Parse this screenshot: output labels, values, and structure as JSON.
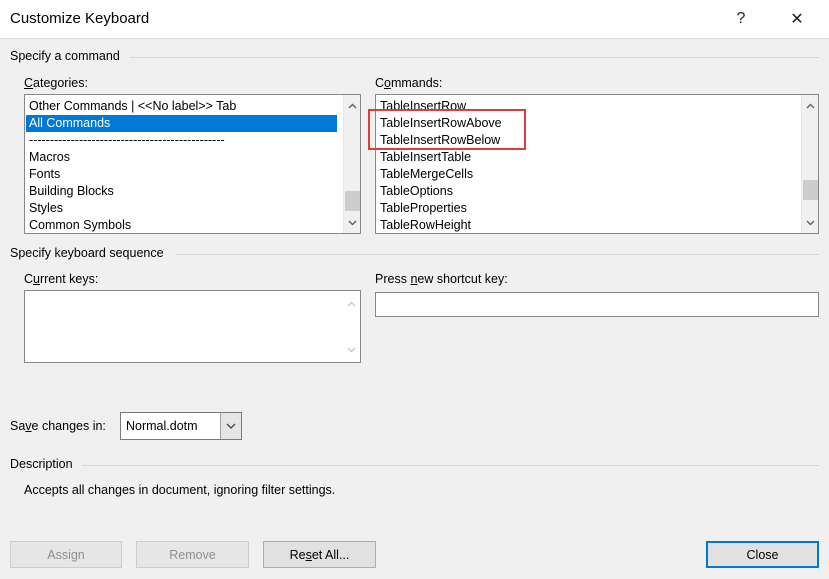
{
  "window": {
    "title": "Customize Keyboard",
    "help_label": "?",
    "close_label": "✕"
  },
  "specify_command": {
    "group_label": "Specify a command",
    "categories_label_u": "C",
    "categories_label_rest": "ategories:",
    "categories": [
      "Other Commands | <<No label>> Tab",
      "All Commands",
      "-----------------------------------------------",
      "Macros",
      "Fonts",
      "Building Blocks",
      "Styles",
      "Common Symbols"
    ],
    "categories_selected": "All Commands",
    "commands_label_u": "o",
    "commands_label_pre": "C",
    "commands_label_rest": "mmands:",
    "commands": [
      "TableInsertRow",
      "TableInsertRowAbove",
      "TableInsertRowBelow",
      "TableInsertTable",
      "TableMergeCells",
      "TableOptions",
      "TableProperties",
      "TableRowHeight"
    ]
  },
  "keyboard_sequence": {
    "group_label": "Specify keyboard sequence",
    "current_keys_label_u": "u",
    "current_keys_label_pre": "C",
    "current_keys_label_rest": "rrent keys:",
    "press_new_label_pre": "Press ",
    "press_new_label_u": "n",
    "press_new_label_rest": "ew shortcut key:",
    "new_shortcut_value": ""
  },
  "save_changes": {
    "label_pre": "Sa",
    "label_u": "v",
    "label_rest": "e changes in:",
    "selected": "Normal.dotm"
  },
  "description": {
    "group_label": "Description",
    "text": "Accepts all changes in document, ignoring filter settings."
  },
  "buttons": {
    "assign": "Assign",
    "remove": "Remove",
    "reset_all_pre": "Re",
    "reset_all_u": "s",
    "reset_all_rest": "et All...",
    "close": "Close"
  }
}
